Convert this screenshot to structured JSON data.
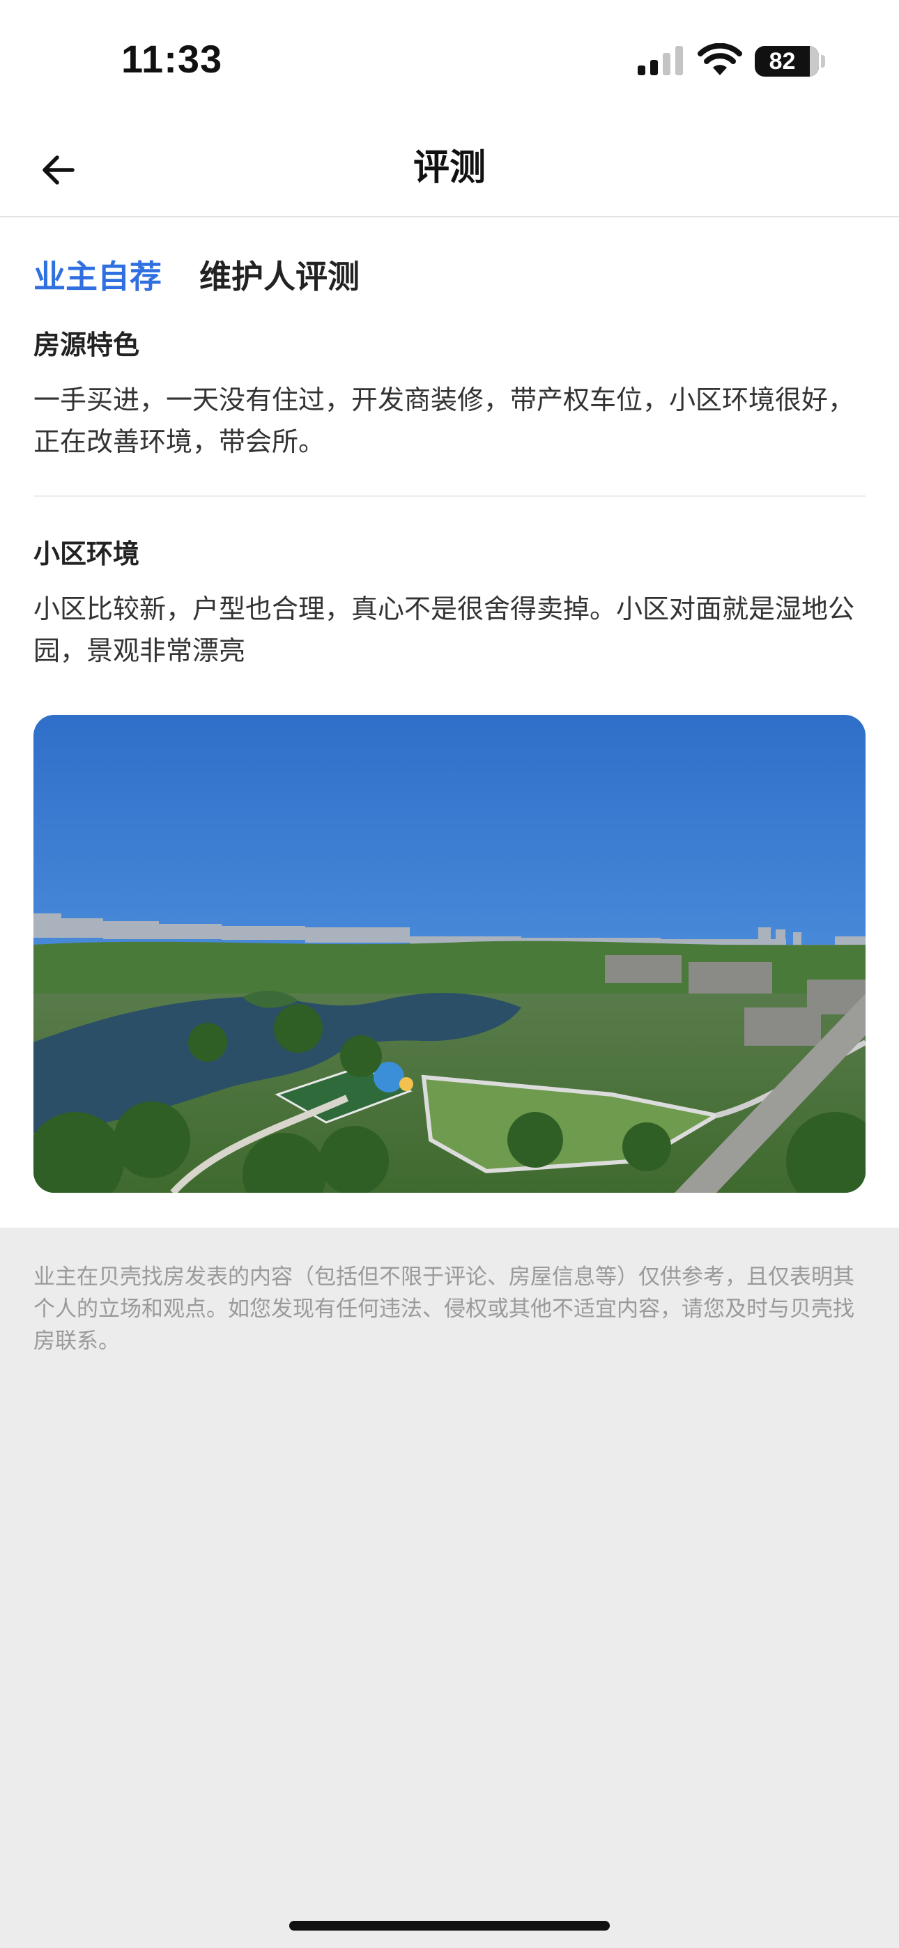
{
  "status_bar": {
    "time": "11:33",
    "battery_level": "82",
    "icons": [
      "signal-icon",
      "wifi-icon",
      "battery-icon"
    ]
  },
  "nav": {
    "title": "评测",
    "back_icon": "arrow-left-icon"
  },
  "tabs": [
    {
      "label": "业主自荐",
      "active": true
    },
    {
      "label": "维护人评测",
      "active": false
    }
  ],
  "sections": [
    {
      "title": "房源特色",
      "text": "一手买进，一天没有住过，开发商装修，带产权车位，小区环境很好，正在改善环境，带会所。"
    },
    {
      "title": "小区环境",
      "text": "小区比较新，户型也合理，真心不是很舍得卖掉。小区对面就是湿地公园，景观非常漂亮"
    }
  ],
  "disclaimer": "业主在贝壳找房发表的内容（包括但不限于评论、房屋信息等）仅供参考，且仅表明其个人的立场和观点。如您发现有任何违法、侵权或其他不适宜内容，请您及时与贝壳找房联系。",
  "colors": {
    "accent": "#2f6fe0",
    "text": "#222222",
    "muted": "#9a9a9a",
    "page_bg": "#ececec"
  }
}
